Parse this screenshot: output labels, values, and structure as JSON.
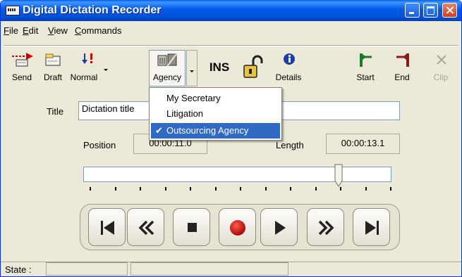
{
  "window": {
    "title": "Digital Dictation Recorder"
  },
  "menubar": [
    "File",
    "Edit",
    "View",
    "Commands"
  ],
  "toolbar": {
    "send": "Send",
    "draft": "Draft",
    "priority": "Normal",
    "category": "Agency",
    "ins": "INS",
    "details": "Details",
    "start": "Start",
    "end": "End",
    "clip": "Clip"
  },
  "agency_menu": {
    "items": [
      "My Secretary",
      "Litigation",
      "Outsourcing Agency"
    ],
    "selected": "Outsourcing Agency"
  },
  "form": {
    "title_label": "Title",
    "title_value": "Dictation title",
    "position_label": "Position",
    "position_value": "00:00:11.0",
    "length_label": "Length",
    "length_value": "00:00:13.1"
  },
  "slider": {
    "position_fraction": 0.84
  },
  "status": {
    "label": "State :",
    "state": "",
    "info": ""
  },
  "icons": {
    "send": "send-arrow-icon",
    "draft": "draft-icon",
    "priority": "priority-exclamation-icon",
    "agency": "agency-icon",
    "lock": "unlocked-padlock-icon",
    "details": "info-icon",
    "start": "start-marker-icon",
    "end": "end-marker-icon",
    "clip": "clip-x-icon"
  },
  "colors": {
    "titlebar": "#0054e3",
    "selection": "#316ac5",
    "record": "#c00000",
    "start_marker": "#1a7a2a",
    "end_marker": "#8b1a1a"
  }
}
